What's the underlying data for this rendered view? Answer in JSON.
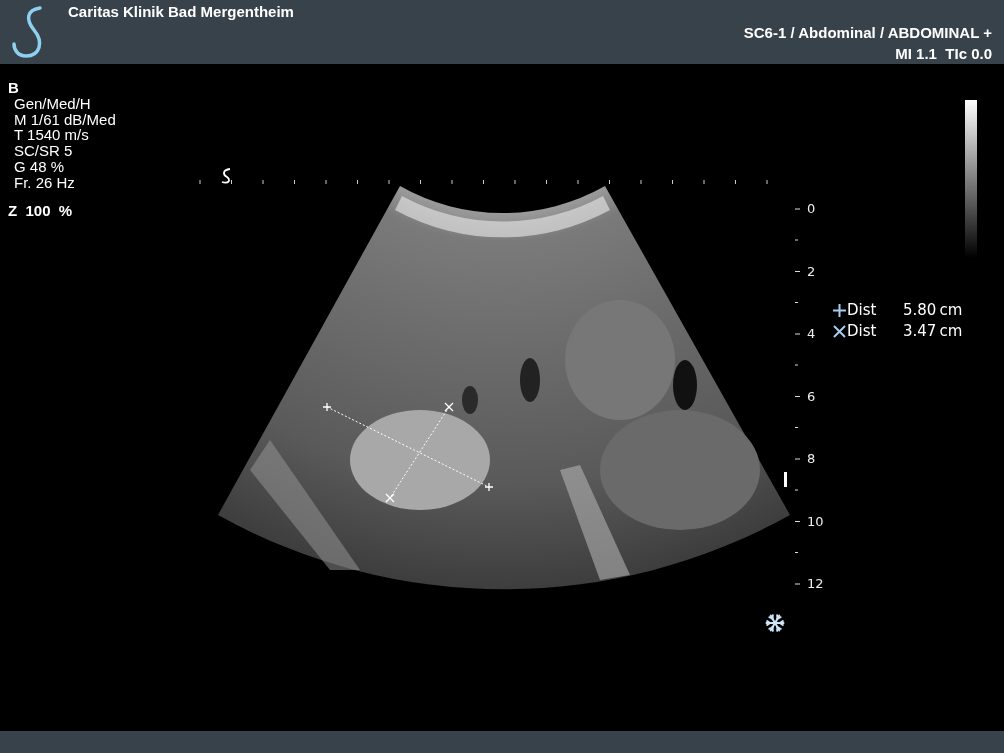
{
  "header": {
    "institution": "Caritas Klinik Bad Mergentheim",
    "preset": "SC6-1 / Abdominal / ABDOMINAL +",
    "indices": "MI 1.1  TIc 0.0"
  },
  "mode": "B",
  "parameters": [
    "Gen/Med/H",
    "M 1/61 dB/Med",
    "T 1540 m/s",
    "SC/SR 5",
    "G 48 %",
    "Fr. 26 Hz"
  ],
  "zoom": "Z  100  %",
  "depth_scale": [
    "0",
    "2",
    "4",
    "6",
    "8",
    "10",
    "12"
  ],
  "measurements": [
    {
      "kind": "plus",
      "label": "Dist",
      "value": "5.80",
      "unit": "cm"
    },
    {
      "kind": "cross",
      "label": "Dist",
      "value": "3.47",
      "unit": "cm"
    }
  ],
  "frozen": true
}
